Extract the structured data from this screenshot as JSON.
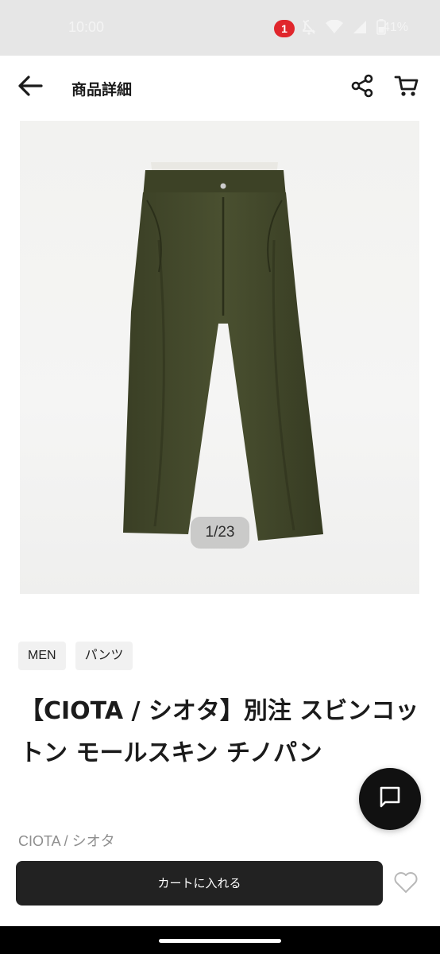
{
  "status_bar": {
    "time": "10:00",
    "notification_count": "1",
    "battery": "41%",
    "icons": [
      "notifications-off-icon",
      "wifi-icon",
      "signal-icon",
      "battery-icon"
    ]
  },
  "app_bar": {
    "title": "商品詳細",
    "back_icon": "arrow-left-icon",
    "share_icon": "share-icon",
    "cart_icon": "cart-icon"
  },
  "product": {
    "image_counter": "1/23",
    "tags": [
      "MEN",
      "パンツ"
    ],
    "name": "【CIOTA / シオタ】別注 スビンコットン モールスキン チノパン",
    "brand": "CIOTA / シオタ"
  },
  "actions": {
    "add_to_cart_label": "カートに入れる",
    "chat_icon": "chat-icon",
    "favorite_icon": "heart-icon"
  },
  "colors": {
    "status_bar_bg": "#e6e6e6",
    "primary_button": "#222222",
    "badge": "#e0262c",
    "product_color": "#3f4428"
  }
}
